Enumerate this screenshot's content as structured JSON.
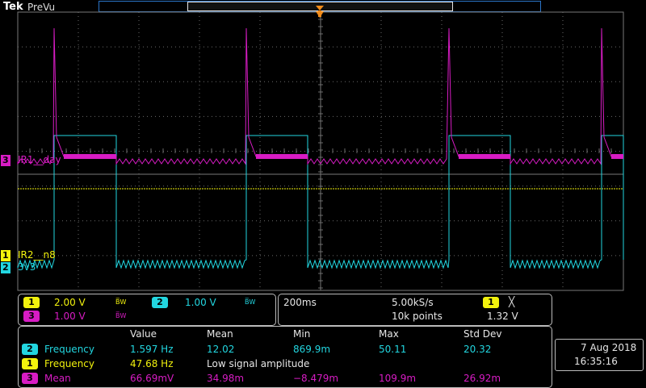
{
  "header": {
    "brand": "Tek",
    "mode": "PreVu"
  },
  "channels": {
    "ch1": {
      "number": "1",
      "label": "IR2__n8",
      "scale": "2.00 V",
      "bw": "B̅W",
      "color": "#f2f20d"
    },
    "ch2": {
      "number": "2",
      "label": "3v3",
      "scale": "1.00 V",
      "bw": "B̅W",
      "color": "#22d6e0"
    },
    "ch3": {
      "number": "3",
      "label": "IR1__day",
      "scale": "1.00 V",
      "bw": "B̅W",
      "color": "#d81cc4"
    }
  },
  "timebase": {
    "horizontal": "200ms",
    "sample_rate": "5.00kS/s",
    "record_length": "10k points",
    "trigger_channel": "1",
    "trigger_symbol": "╳",
    "trigger_level": "1.32 V"
  },
  "measurements": {
    "headers": [
      "Value",
      "Mean",
      "Min",
      "Max",
      "Std Dev"
    ],
    "rows": [
      {
        "channel": "2",
        "name": "Frequency",
        "value": "1.597 Hz",
        "mean": "12.02",
        "min": "869.9m",
        "max": "50.11",
        "std": "20.32"
      },
      {
        "channel": "1",
        "name": "Frequency",
        "value": "47.68 Hz",
        "note": "Low signal amplitude"
      },
      {
        "channel": "3",
        "name": "Mean",
        "value": "66.69mV",
        "mean": "34.98m",
        "min": "−8.479m",
        "max": "109.9m",
        "std": "26.92m"
      }
    ]
  },
  "datetime": {
    "date": "7 Aug 2018",
    "time": "16:35:16"
  },
  "colors": {
    "grid": "#6a6a6a",
    "ch1": "#f2f20d",
    "ch2": "#22d6e0",
    "ch3": "#d81cc4",
    "trigger_marker": "#f28c1a"
  },
  "icons": {
    "trigger_position": "trigger-position-marker-icon"
  }
}
